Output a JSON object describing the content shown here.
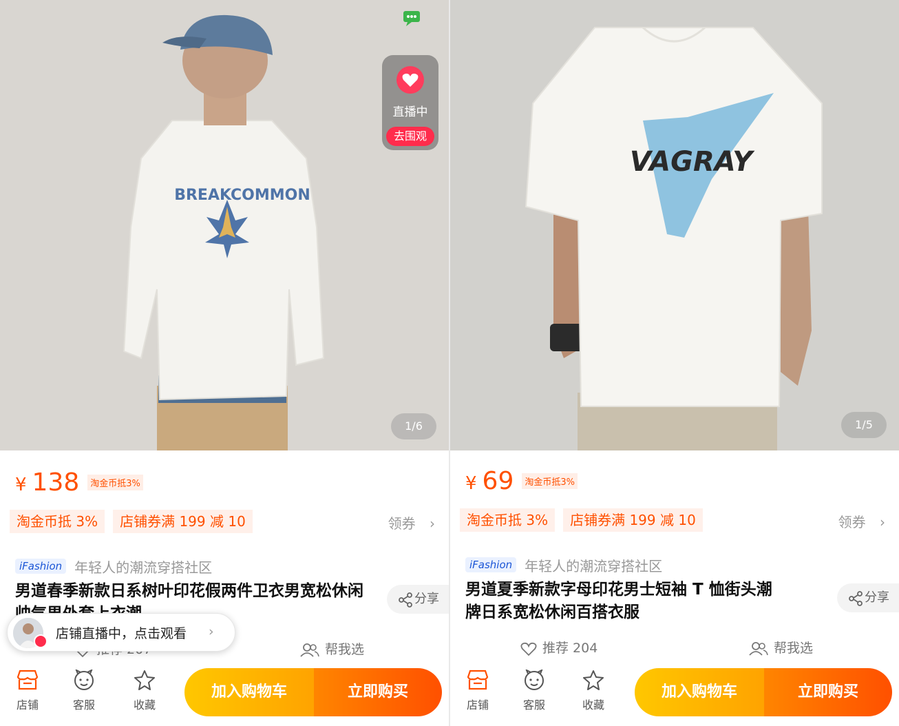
{
  "colors": {
    "accent": "#ff5000",
    "cart": "#ffb000",
    "live": "#ff2c4c"
  },
  "left": {
    "pager": "1/6",
    "live_badge": {
      "status": "直播中",
      "action": "去围观"
    },
    "currency": "¥",
    "price": "138",
    "price_tag": "淘金币抵3%",
    "coupons": [
      "淘金币抵 3%",
      "店铺券满 199 减 10"
    ],
    "get_coupon": "领券",
    "brand_logo": "iFashion",
    "brand_slogan": "年轻人的潮流穿搭社区",
    "title": "男道春季新款日系树叶印花假两件卫衣男宽松休闲帅气男外套上衣潮",
    "share": "分享",
    "recommend": "推荐 207",
    "help_choose": "帮我选",
    "toast": "店铺直播中，点击观看",
    "toolbar": {
      "shop": "店铺",
      "service": "客服",
      "favorite": "收藏"
    },
    "add_to_cart": "加入购物车",
    "buy_now": "立即购买",
    "print_text": "BREAKCOMMON"
  },
  "right": {
    "pager": "1/5",
    "currency": "¥",
    "price": "69",
    "price_tag": "淘金币抵3%",
    "coupons": [
      "淘金币抵 3%",
      "店铺券满 199 减 10"
    ],
    "get_coupon": "领券",
    "brand_logo": "iFashion",
    "brand_slogan": "年轻人的潮流穿搭社区",
    "title_line1": "男道夏季新款字母印花男士短袖 T 恤街头潮",
    "title_line2": "牌日系宽松休闲百搭衣服",
    "share": "分享",
    "recommend": "推荐 204",
    "help_choose": "帮我选",
    "toolbar": {
      "shop": "店铺",
      "service": "客服",
      "favorite": "收藏"
    },
    "add_to_cart": "加入购物车",
    "buy_now": "立即购买",
    "print_text": "VAGRAY"
  }
}
